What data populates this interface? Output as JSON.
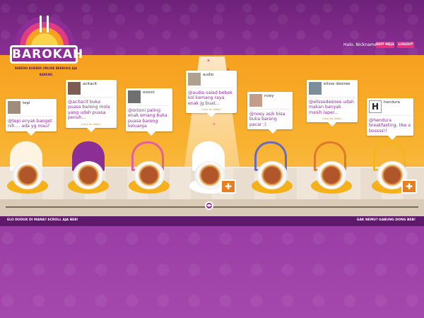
{
  "app": {
    "logo_title": "BAROKAH",
    "logo_tagline": "BARENG BUKBER ONLINE BERBUKA AJA BARENG"
  },
  "user_panel": {
    "greeting": "Halo, Nickname",
    "edit_button": "EDIT MEJA",
    "logout_button": "LOGOUT"
  },
  "seats": [
    {
      "username": "tepi",
      "message": "@tepi enyak banget nih.... ada yg mau?",
      "more": "",
      "chair_color": "#ffffff"
    },
    {
      "username": "acitacit",
      "message": "@acitacit buka puasa bareng mola yang udah puasa penuh...",
      "more": "(click for detail)",
      "chair_color": "#8b2f96"
    },
    {
      "username": "ooioni",
      "message": "@onioni paling enak emang buka puasa bareng keluarga",
      "more": "",
      "chair_color": "#e2609f"
    },
    {
      "username": "audio",
      "message": "@audio salad bebek kol kemang raya enak jg buat...",
      "more": "(click for detail)",
      "chair_color": "#ffffff"
    },
    {
      "username": "noey",
      "message": "@noey asik bisa buka bareng pacar :)",
      "more": "",
      "chair_color": "#6b6bb7"
    },
    {
      "username": "elisse desiree",
      "message": "@elissedesiree udah makan banyak masih laper...",
      "more": "(click for detail)",
      "chair_color": "#e07a2b"
    },
    {
      "username": "hendura",
      "message": "@hendura breakfasting, like a bossss!!",
      "more": "",
      "chair_color": "#f3b61c"
    }
  ],
  "footer": {
    "left_text": "ELO DUDUK DI MANA? SCROLL AJA BEB!",
    "right_text": "GAK NEMU? GABUNG DONG BEB!"
  },
  "colors": {
    "purple": "#8b2f96",
    "orange": "#f6a11f",
    "pink": "#e0317f"
  }
}
